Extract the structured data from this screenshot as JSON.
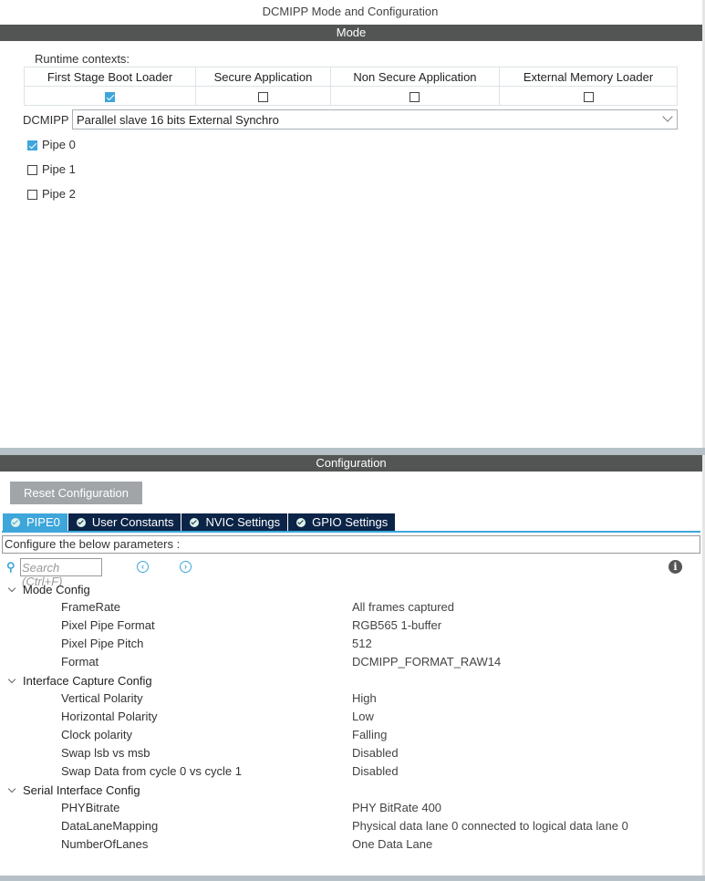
{
  "title": "DCMIPP Mode and Configuration",
  "mode": {
    "header": "Mode",
    "runtime_label": "Runtime contexts:",
    "contexts": [
      {
        "label": "First Stage Boot Loader",
        "checked": true
      },
      {
        "label": "Secure Application",
        "checked": false
      },
      {
        "label": "Non Secure Application",
        "checked": false
      },
      {
        "label": "External Memory Loader",
        "checked": false
      }
    ],
    "dcmipp_label": "DCMIPP",
    "dcmipp_value": "Parallel slave 16 bits External Synchro",
    "pipes": [
      {
        "label": "Pipe 0",
        "checked": true
      },
      {
        "label": "Pipe 1",
        "checked": false
      },
      {
        "label": "Pipe 2",
        "checked": false
      }
    ]
  },
  "config": {
    "header": "Configuration",
    "reset_label": "Reset Configuration",
    "tabs": [
      "PIPE0",
      "User Constants",
      "NVIC Settings",
      "GPIO Settings"
    ],
    "params_label": "Configure the below parameters :",
    "search_placeholder": "Search (Ctrl+F)",
    "groups": [
      {
        "name": "Mode Config",
        "items": [
          [
            "FrameRate",
            "All frames captured"
          ],
          [
            "Pixel Pipe Format",
            "RGB565 1-buffer"
          ],
          [
            "Pixel Pipe Pitch",
            "512"
          ],
          [
            "Format",
            "DCMIPP_FORMAT_RAW14"
          ]
        ]
      },
      {
        "name": "Interface Capture Config",
        "items": [
          [
            "Vertical Polarity",
            "High"
          ],
          [
            "Horizontal Polarity",
            "Low"
          ],
          [
            "Clock polarity",
            "Falling"
          ],
          [
            "Swap lsb vs msb",
            "Disabled"
          ],
          [
            "Swap Data from cycle 0 vs cycle 1",
            "Disabled"
          ]
        ]
      },
      {
        "name": "Serial Interface Config",
        "items": [
          [
            "PHYBitrate",
            "PHY BitRate 400"
          ],
          [
            "DataLaneMapping",
            "Physical data lane 0 connected to logical data lane 0"
          ],
          [
            "NumberOfLanes",
            "One Data Lane"
          ]
        ]
      }
    ]
  },
  "colors": {
    "accent": "#3ea6db",
    "tab_dark": "#0b2447",
    "header_bar": "#525553"
  }
}
